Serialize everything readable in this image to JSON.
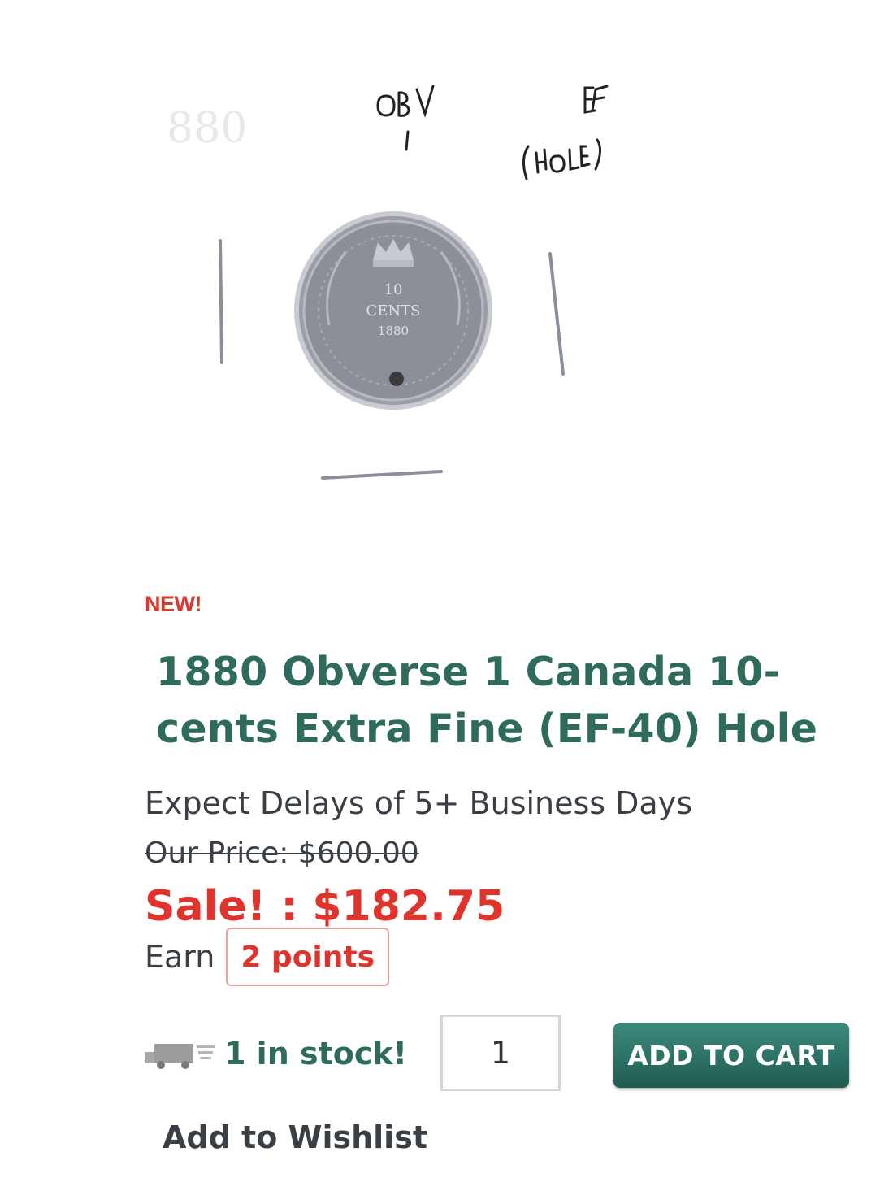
{
  "product": {
    "image": {
      "handwritten_grade_note": "OBV 1 EF (HOLE)"
    },
    "badge": "NEW!",
    "title": "1880 Obverse 1 Canada 10-cents Extra Fine (EF-40) Hole",
    "delay_note": "Expect Delays of 5+ Business Days",
    "old_price": "Our Price: $600.00",
    "sale_price": "Sale! : $182.75",
    "earn_label": "Earn",
    "points": "2 points",
    "stock_text": "1 in stock!",
    "quantity": "1",
    "add_to_cart_label": "ADD TO CART",
    "wishlist_label": "Add to Wishlist"
  },
  "icons": {
    "shipping": "truck-icon"
  },
  "colors": {
    "title": "#2e6b5c",
    "sale": "#e0332b",
    "badge": "#d9382e",
    "button": "#2a7566",
    "text": "#3a3f45"
  }
}
